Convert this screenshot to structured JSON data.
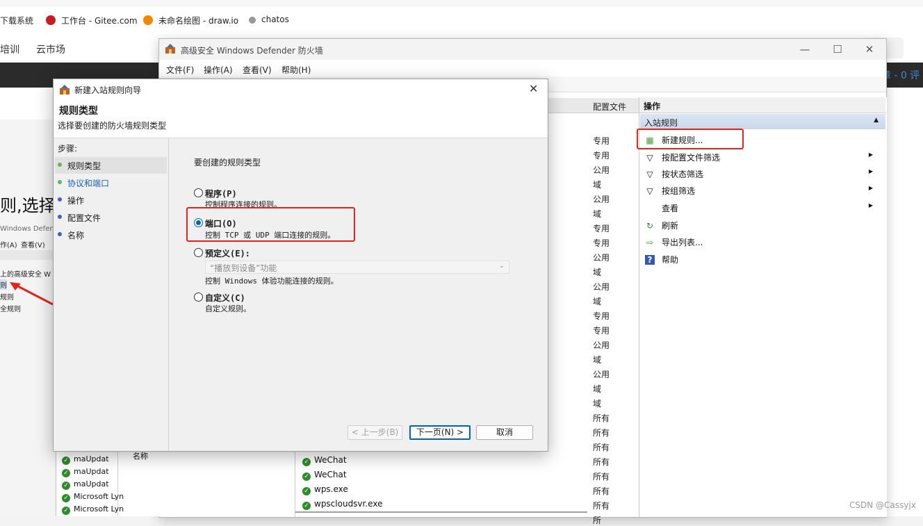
{
  "browser": {
    "bookmarks": [
      "下载系统",
      "工作台 - Gitee.com",
      "未命名绘图 - draw.io",
      "chatos"
    ]
  },
  "website": {
    "nav": [
      "培训",
      "云市场"
    ],
    "heading": "则,选择",
    "counts": "章 - 0  评",
    "snippets": [
      "Windows Defend",
      "作(A)",
      "查看(V)",
      "上的高级安全 W",
      "则",
      "规则",
      "全规则"
    ],
    "bottom_left_rules": [
      "maUpdat",
      "maUpdat",
      "maUpdat",
      "Microsoft Lyn",
      "Microsoft Lyn"
    ],
    "bottom_left_step": "名称"
  },
  "firewall": {
    "title": "高级安全 Windows Defender 防火墙",
    "menu": [
      "文件(F)",
      "操作(A)",
      "查看(V)",
      "帮助(H)"
    ],
    "column_profile": "配置文件",
    "profiles": [
      "专用",
      "专用",
      "公用",
      "域",
      "公用",
      "域",
      "专用",
      "专用",
      "公用",
      "域",
      "公用",
      "域",
      "专用",
      "专用",
      "公用",
      "域",
      "公用",
      "域",
      "域",
      "所有",
      "所有",
      "所有",
      "所有",
      "所有",
      "所有",
      "所有",
      "所"
    ],
    "visible_rules": [
      "WeChat",
      "WeChat",
      "wps.exe",
      "wpscloudsvr.exe"
    ],
    "actions": {
      "header": "操作",
      "section": "入站规则",
      "items": [
        {
          "label": "新建规则...",
          "icon": "new-rule-icon",
          "submenu": false
        },
        {
          "label": "按配置文件筛选",
          "icon": "filter-icon",
          "submenu": true
        },
        {
          "label": "按状态筛选",
          "icon": "filter-icon",
          "submenu": true
        },
        {
          "label": "按组筛选",
          "icon": "filter-icon",
          "submenu": true
        },
        {
          "label": "查看",
          "icon": "",
          "submenu": true
        },
        {
          "label": "刷新",
          "icon": "refresh-icon",
          "submenu": false
        },
        {
          "label": "导出列表...",
          "icon": "export-icon",
          "submenu": false
        },
        {
          "label": "帮助",
          "icon": "help-icon",
          "submenu": false
        }
      ]
    }
  },
  "wizard": {
    "title": "新建入站规则向导",
    "header_title": "规则类型",
    "header_subtitle": "选择要创建的防火墙规则类型",
    "steps_label": "步骤:",
    "steps": [
      {
        "label": "规则类型",
        "dot": "#5cb85c",
        "active": true
      },
      {
        "label": "协议和端口",
        "dot": "#5cb85c",
        "link": true
      },
      {
        "label": "操作",
        "dot": "#4a5fb0"
      },
      {
        "label": "配置文件",
        "dot": "#4a5fb0"
      },
      {
        "label": "名称",
        "dot": "#4a5fb0"
      }
    ],
    "prompt": "要创建的规则类型",
    "options": [
      {
        "label": "程序(P)",
        "desc": "控制程序连接的规则。",
        "selected": false
      },
      {
        "label": "端口(O)",
        "desc": "控制 TCP 或 UDP 端口连接的规则。",
        "selected": true
      },
      {
        "label": "预定义(E):",
        "desc": "控制 Windows 体验功能连接的规则。",
        "selected": false
      },
      {
        "label": "自定义(C)",
        "desc": "自定义规则。",
        "selected": false
      }
    ],
    "predefined_select": "“播放到设备”功能",
    "buttons": {
      "back": "< 上一步(B)",
      "next": "下一页(N) >",
      "cancel": "取消"
    }
  },
  "watermark": "CSDN @Cassyjx",
  "colors": {
    "annotation": "#e2241c",
    "accent": "#005fb8"
  }
}
